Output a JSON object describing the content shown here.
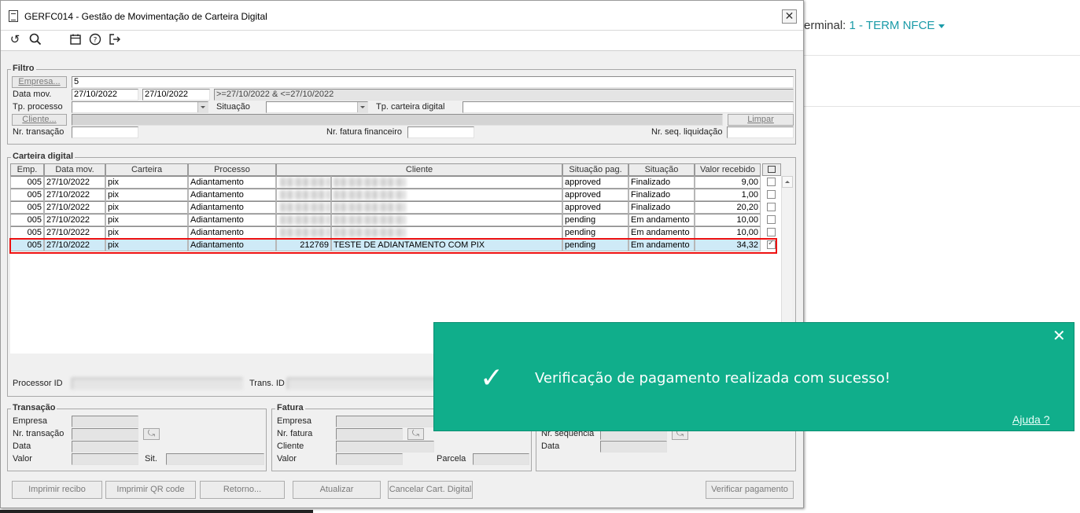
{
  "background": {
    "terminal_label": "erminal: ",
    "terminal_value": "1 - TERM NFCE"
  },
  "window": {
    "title": "GERFC014 - Gestão de Movimentação de Carteira Digital",
    "close_glyph": "✕",
    "toolbar_icons": [
      "undo-icon",
      "search-icon",
      "calendar-icon",
      "help-icon",
      "exit-icon"
    ]
  },
  "filtro": {
    "legend": "Filtro",
    "empresa_btn": "Empresa...",
    "empresa_value": "5",
    "data_mov_label": "Data mov.",
    "data_mov_from": "27/10/2022",
    "data_mov_to": "27/10/2022",
    "data_mov_expr": ">=27/10/2022 & <=27/10/2022",
    "tp_processo_label": "Tp. processo",
    "situacao_label": "Situação",
    "tp_carteira_label": "Tp. carteira digital",
    "cliente_btn": "Cliente...",
    "limpar_btn": "Limpar",
    "nr_transacao_label": "Nr. transação",
    "nr_fatura_label": "Nr. fatura financeiro",
    "nr_seq_label": "Nr. seq. liquidação"
  },
  "carteira": {
    "legend": "Carteira digital",
    "columns": [
      "Emp.",
      "Data mov.",
      "Carteira",
      "Processo",
      "Cliente",
      "Situação pag.",
      "Situação",
      "Valor recebido"
    ],
    "rows": [
      {
        "emp": "005",
        "data": "27/10/2022",
        "carteira": "pix",
        "processo": "Adiantamento",
        "cli_cod": "",
        "cli_nome": "",
        "sit_pag": "approved",
        "situacao": "Finalizado",
        "valor": "9,00",
        "checked": false
      },
      {
        "emp": "005",
        "data": "27/10/2022",
        "carteira": "pix",
        "processo": "Adiantamento",
        "cli_cod": "",
        "cli_nome": "",
        "sit_pag": "approved",
        "situacao": "Finalizado",
        "valor": "1,00",
        "checked": false
      },
      {
        "emp": "005",
        "data": "27/10/2022",
        "carteira": "pix",
        "processo": "Adiantamento",
        "cli_cod": "",
        "cli_nome": "",
        "sit_pag": "approved",
        "situacao": "Finalizado",
        "valor": "20,20",
        "checked": false
      },
      {
        "emp": "005",
        "data": "27/10/2022",
        "carteira": "pix",
        "processo": "Adiantamento",
        "cli_cod": "",
        "cli_nome": "",
        "sit_pag": "pending",
        "situacao": "Em andamento",
        "valor": "10,00",
        "checked": false
      },
      {
        "emp": "005",
        "data": "27/10/2022",
        "carteira": "pix",
        "processo": "Adiantamento",
        "cli_cod": "",
        "cli_nome": "",
        "sit_pag": "pending",
        "situacao": "Em andamento",
        "valor": "10,00",
        "checked": false
      },
      {
        "emp": "005",
        "data": "27/10/2022",
        "carteira": "pix",
        "processo": "Adiantamento",
        "cli_cod": "212769",
        "cli_nome": "TESTE DE ADIANTAMENTO COM PIX",
        "sit_pag": "pending",
        "situacao": "Em andamento",
        "valor": "34,32",
        "checked": true
      }
    ],
    "processor_id_label": "Processor ID",
    "trans_id_label": "Trans. ID"
  },
  "transacao": {
    "legend": "Transação",
    "empresa_label": "Empresa",
    "nr_transacao_label": "Nr. transação",
    "data_label": "Data",
    "valor_label": "Valor",
    "sit_label": "Sit."
  },
  "fatura": {
    "legend": "Fatura",
    "empresa_label": "Empresa",
    "nr_fatura_label": "Nr. fatura",
    "cliente_label": "Cliente",
    "valor_label": "Valor",
    "parcela_label": "Parcela"
  },
  "liquidacao": {
    "nr_sequencia_label": "Nr. sequência",
    "data_label": "Data"
  },
  "buttons": {
    "imprimir_recibo": "Imprimir recibo",
    "imprimir_qr": "Imprimir QR code",
    "retorno": "Retorno...",
    "atualizar": "Atualizar",
    "cancelar": "Cancelar Cart. Digital",
    "verificar": "Verificar pagamento"
  },
  "toast": {
    "message": "Verificação de pagamento realizada com sucesso!",
    "help": "Ajuda ?",
    "close_glyph": "✕",
    "check_glyph": "✓",
    "color": "#10ae8b"
  }
}
